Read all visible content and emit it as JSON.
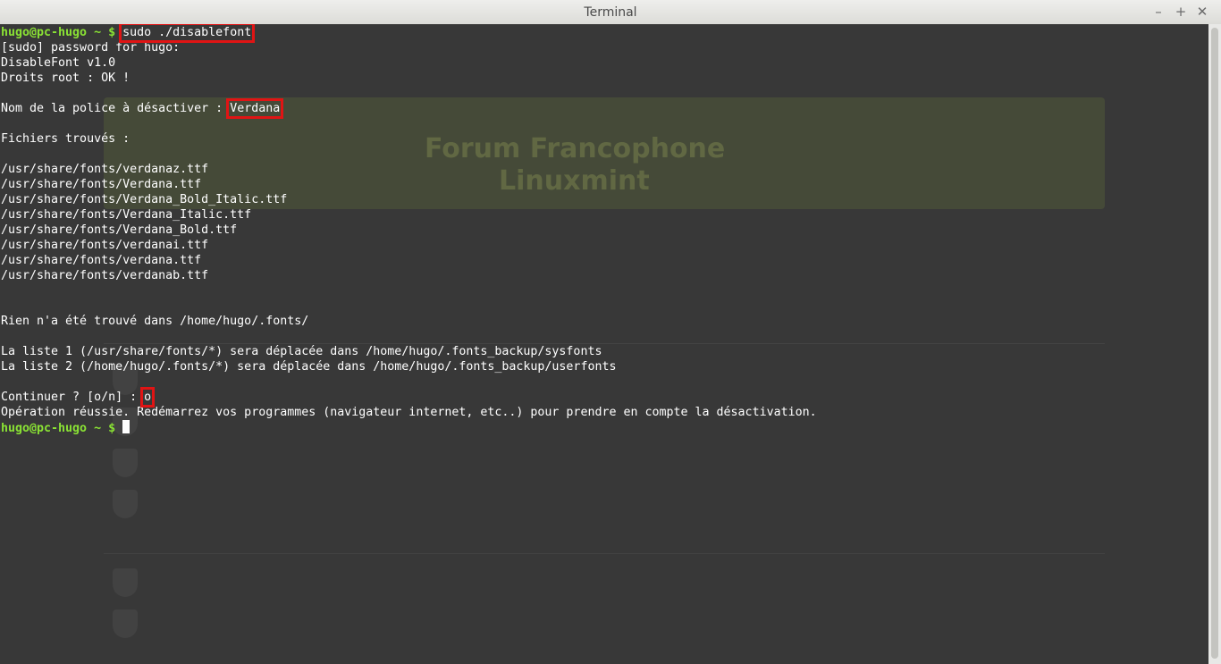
{
  "window": {
    "title": "Terminal",
    "controls": {
      "minimize": "–",
      "maximize": "+",
      "close": "✕"
    }
  },
  "terminal": {
    "command_line": {
      "prompt": "hugo@pc-hugo ~ $",
      "command": "sudo ./disablefont"
    },
    "output": [
      "[sudo] password for hugo:",
      "DisableFont v1.0",
      "Droits root : OK !",
      "",
      "Nom de la police à désactiver : ",
      "",
      "Fichiers trouvés :",
      "",
      "/usr/share/fonts/verdanaz.ttf",
      "/usr/share/fonts/Verdana.ttf",
      "/usr/share/fonts/Verdana_Bold_Italic.ttf",
      "/usr/share/fonts/Verdana_Italic.ttf",
      "/usr/share/fonts/Verdana_Bold.ttf",
      "/usr/share/fonts/verdanai.ttf",
      "/usr/share/fonts/verdana.ttf",
      "/usr/share/fonts/verdanab.ttf",
      "",
      "",
      "Rien n'a été trouvé dans /home/hugo/.fonts/",
      "",
      "La liste 1 (/usr/share/fonts/*) sera déplacée dans /home/hugo/.fonts_backup/sysfonts",
      "La liste 2 (/home/hugo/.fonts/*) sera déplacée dans /home/hugo/.fonts_backup/userfonts",
      "",
      "Continuer ? [o/n] : ",
      "Opération réussie. Redémarrez vos programmes (navigateur internet, etc..) pour prendre en compte la désactivation."
    ],
    "font_answer": "Verdana",
    "confirm_answer": "o",
    "final_prompt": "hugo@pc-hugo ~ $"
  },
  "background_page": {
    "banner_line1": "Forum Francophone",
    "banner_line2": "Linuxmint"
  },
  "colors": {
    "prompt": "#8ae234",
    "highlight_box": "#e01414",
    "text": "#ffffff",
    "background": "#383838"
  },
  "icons": [
    "minimize-icon",
    "maximize-icon",
    "close-icon",
    "cursor-block"
  ]
}
